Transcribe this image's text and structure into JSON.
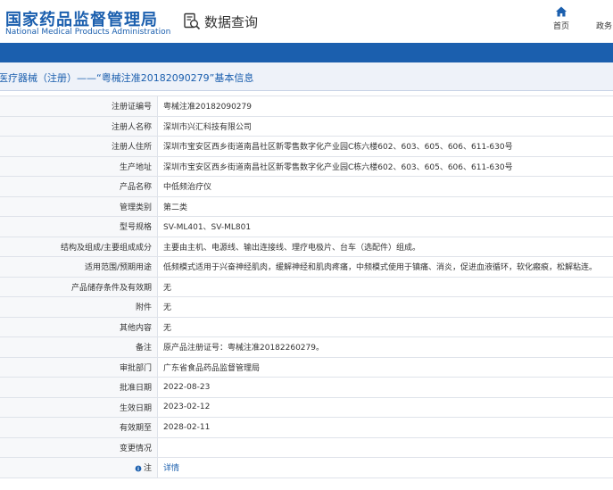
{
  "header": {
    "logo_cn": "国家药品监督管理局",
    "logo_en": "National Medical Products Administration",
    "query_label": "数据查询",
    "nav": [
      {
        "label": "首页",
        "icon": "home-icon"
      },
      {
        "label": "政务"
      }
    ]
  },
  "colors": {
    "brand_blue": "#1b5fae",
    "subhead_bg": "#eef2f9"
  },
  "page": {
    "title": "医疗器械（注册）——“粤械注准20182090279”基本信息"
  },
  "rows": [
    {
      "label": "注册证编号",
      "value": "粤械注准20182090279"
    },
    {
      "label": "注册人名称",
      "value": "深圳市兴汇科技有限公司"
    },
    {
      "label": "注册人住所",
      "value": "深圳市宝安区西乡街道南昌社区新零售数字化产业园C栋六楼602、603、605、606、611-630号"
    },
    {
      "label": "生产地址",
      "value": "深圳市宝安区西乡街道南昌社区新零售数字化产业园C栋六楼602、603、605、606、611-630号"
    },
    {
      "label": "产品名称",
      "value": "中低频治疗仪"
    },
    {
      "label": "管理类别",
      "value": "第二类"
    },
    {
      "label": "型号规格",
      "value": "SV-ML401、SV-ML801"
    },
    {
      "label": "结构及组成/主要组成成分",
      "value": "主要由主机、电源线、输出连接线、理疗电极片、台车（选配件）组成。"
    },
    {
      "label": "适用范围/预期用途",
      "value": "低频模式适用于兴奋神经肌肉，缓解神经和肌肉疼痛，中频模式使用于镇痛、消炎，促进血液循环，软化瘢痕，松解粘连。"
    },
    {
      "label": "产品储存条件及有效期",
      "value": "无"
    },
    {
      "label": "附件",
      "value": "无"
    },
    {
      "label": "其他内容",
      "value": "无"
    },
    {
      "label": "备注",
      "value": "原产品注册证号：粤械注准20182260279。"
    },
    {
      "label": "审批部门",
      "value": "广东省食品药品监督管理局"
    },
    {
      "label": "批准日期",
      "value": "2022-08-23"
    },
    {
      "label": "生效日期",
      "value": "2023-02-12"
    },
    {
      "label": "有效期至",
      "value": "2028-02-11"
    },
    {
      "label": "变更情况",
      "value": ""
    },
    {
      "label": "注",
      "value": "详情",
      "icon": "note-icon"
    }
  ]
}
